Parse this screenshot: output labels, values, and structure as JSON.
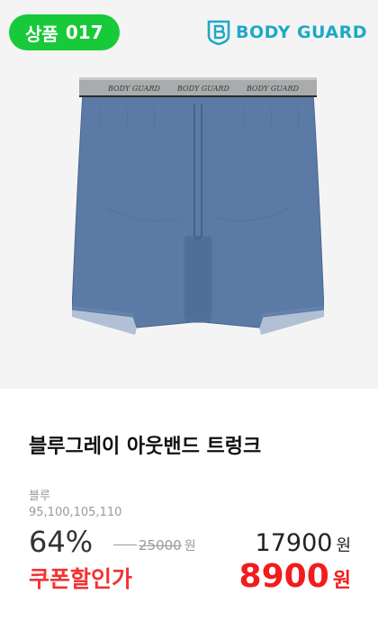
{
  "badge": {
    "prefix": "상품",
    "number": "017"
  },
  "brand": {
    "name": "BODY GUARD",
    "logo_icon": "shield-b-icon",
    "color": "#1fa8c8"
  },
  "waistband_text": [
    "BODY GUARD",
    "BODY GUARD",
    "BODY GUARD"
  ],
  "product": {
    "title": "블루그레이 아웃밴드 트렁크",
    "color": "블루",
    "sizes": "95,100,105,110"
  },
  "price": {
    "discount": "64%",
    "original": "25000",
    "original_unit": "원",
    "sale": "17900",
    "sale_unit": "원",
    "coupon_label": "쿠폰할인가",
    "coupon_price": "8900",
    "coupon_unit": "원"
  },
  "colors": {
    "badge_green": "#18c93a",
    "coupon_red": "#f21c1c",
    "garment_blue": "#5b7aa6"
  }
}
